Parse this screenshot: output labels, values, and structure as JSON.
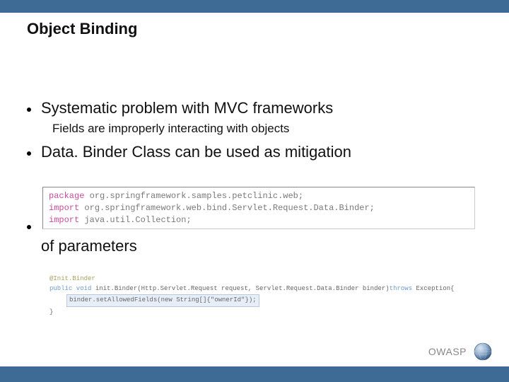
{
  "title": "Object Binding",
  "bullet1": "Systematic problem with MVC frameworks",
  "sub1": "Fields are improperly interacting with objects",
  "bullet2": "Data. Binder Class can be used as mitigation",
  "code1": {
    "kw_package": "package",
    "pkg_line": " org.springframework.samples.petclinic.web;",
    "kw_import": "import",
    "import1": " org.springframework.web.bind.Servlet.Request.Data.Binder;",
    "import2": " java.util.Collection;"
  },
  "bullet3_hidden": "",
  "of_params": "of parameters",
  "code2": {
    "anno": "@Init.Binder",
    "line2_a": "public void",
    "line2_b": " init.Binder(Http.Servlet.Request request, Servlet.Request.Data.Binder binder)",
    "line2_c": "throws",
    "line2_d": " Exception{",
    "line3": "binder.setAllowedFields(new String[]{\"ownerId\"});",
    "line4": "}"
  },
  "footer": "OWASP"
}
